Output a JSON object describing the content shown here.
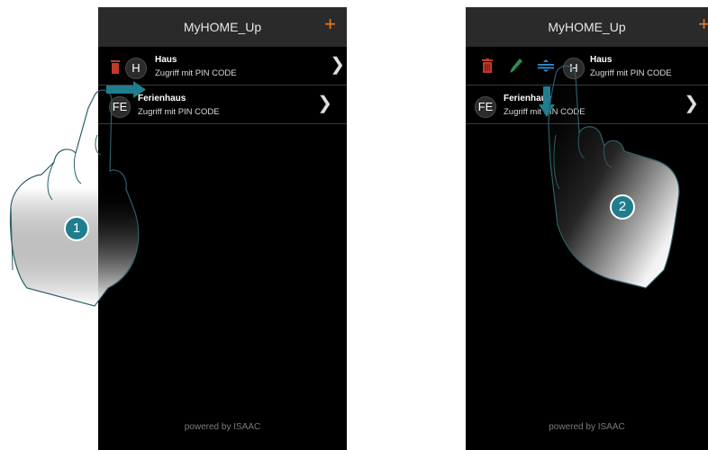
{
  "app_title": "MyHOME_Up",
  "add_label": "+",
  "footer": "powered by ISAAC",
  "items": [
    {
      "initials": "H",
      "name": "Haus",
      "access": "Zugriff mit PIN CODE"
    },
    {
      "initials": "FE",
      "name": "Ferienhaus",
      "access": "Zugriff mit PIN CODE"
    }
  ],
  "step_labels": [
    "1",
    "2"
  ],
  "colors": {
    "accent": "#f07a1a",
    "step_badge": "#1f7d8e",
    "delete_icon": "#c0392b",
    "edit_icon": "#2e8b57",
    "move_icon": "#2c8fd6"
  },
  "icons": [
    "trash-icon",
    "pencil-icon",
    "drag-handle-icon",
    "chevron-right-icon"
  ]
}
